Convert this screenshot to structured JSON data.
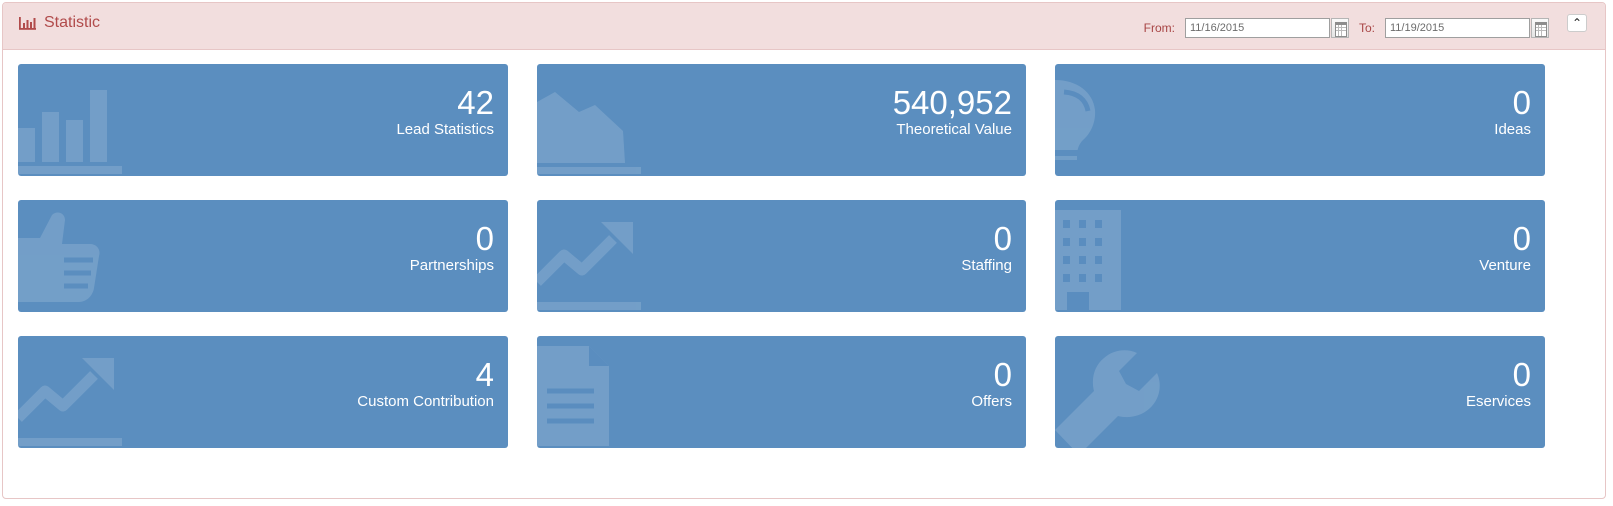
{
  "panel": {
    "title": "Statistic",
    "title_icon": "bar-chart-icon",
    "collapse_icon": "chevron-up-icon",
    "header_color": "#f2dede",
    "title_color": "#b14b4b"
  },
  "date_range": {
    "from_label": "From:",
    "from_value": "11/16/2015",
    "to_label": "To:",
    "to_value": "11/19/2015",
    "calendar_icon": "calendar-icon"
  },
  "tiles": [
    {
      "value": "42",
      "label": "Lead Statistics",
      "icon": "bar-chart-icon"
    },
    {
      "value": "540,952",
      "label": "Theoretical Value",
      "icon": "area-chart-icon"
    },
    {
      "value": "0",
      "label": "Ideas",
      "icon": "lightbulb-icon"
    },
    {
      "value": "0",
      "label": "Partnerships",
      "icon": "thumbs-up-icon"
    },
    {
      "value": "0",
      "label": "Staffing",
      "icon": "trending-up-icon"
    },
    {
      "value": "0",
      "label": "Venture",
      "icon": "building-icon"
    },
    {
      "value": "4",
      "label": "Custom Contribution",
      "icon": "trending-up-icon"
    },
    {
      "value": "0",
      "label": "Offers",
      "icon": "document-icon"
    },
    {
      "value": "0",
      "label": "Eservices",
      "icon": "wrench-icon"
    }
  ],
  "colors": {
    "tile_background": "#5b8ebf",
    "tile_text": "#ffffff"
  }
}
